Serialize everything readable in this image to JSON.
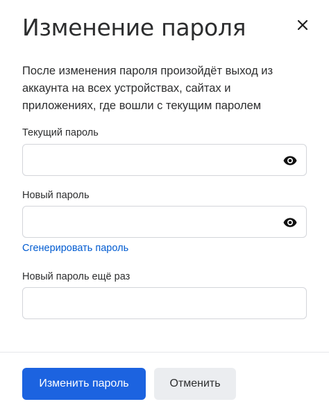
{
  "dialog": {
    "title": "Изменение пароля",
    "description": "После изменения пароля произойдёт выход из аккаунта на всех устройствах, сайтах и приложениях, где вошли с текущим паролем",
    "close_icon": "close-icon"
  },
  "fields": {
    "current_password": {
      "label": "Текущий пароль",
      "value": "",
      "placeholder": "",
      "icon": "eye-icon"
    },
    "new_password": {
      "label": "Новый пароль",
      "value": "",
      "placeholder": "",
      "icon": "eye-icon"
    },
    "generate_link": "Сгенерировать пароль",
    "repeat_password": {
      "label": "Новый пароль ещё раз",
      "value": "",
      "placeholder": ""
    }
  },
  "actions": {
    "submit_label": "Изменить пароль",
    "cancel_label": "Отменить"
  },
  "colors": {
    "primary": "#1c63e0",
    "link": "#005bd1",
    "secondary_bg": "#ebedf0",
    "border": "#d3d5da"
  }
}
